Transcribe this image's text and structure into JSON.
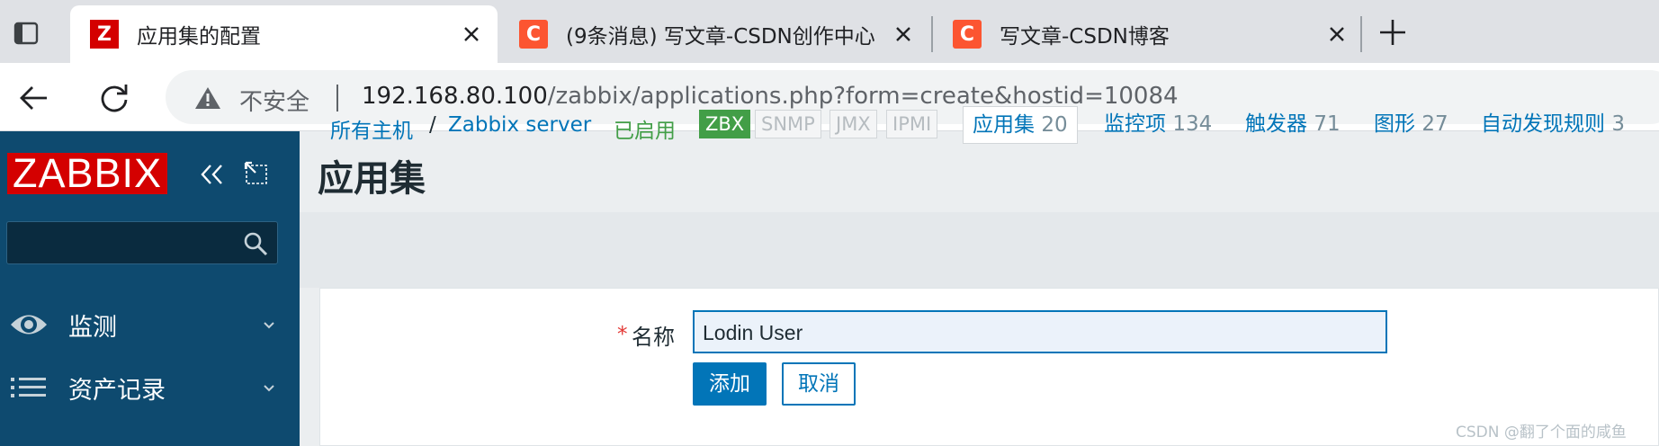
{
  "browser": {
    "tabs": [
      {
        "title": "应用集的配置",
        "favicon": "Z",
        "active": true
      },
      {
        "title": "(9条消息) 写文章-CSDN创作中心",
        "favicon": "C",
        "active": false
      },
      {
        "title": "写文章-CSDN博客",
        "favicon": "C",
        "active": false
      }
    ],
    "security_label": "不安全",
    "url_host": "192.168.80.100",
    "url_path": "/zabbix/applications.php?form=create&hostid=10084"
  },
  "sidebar": {
    "logo": "ZABBIX",
    "search_value": "",
    "items": [
      {
        "label": "监测",
        "icon": "eye-icon"
      },
      {
        "label": "资产记录",
        "icon": "list-icon"
      }
    ]
  },
  "main": {
    "title": "应用集",
    "breadcrumb": {
      "all_hosts": "所有主机",
      "separator": "/",
      "host": "Zabbix server"
    },
    "status": "已启用",
    "availability": [
      {
        "label": "ZBX",
        "on": true
      },
      {
        "label": "SNMP",
        "on": false
      },
      {
        "label": "JMX",
        "on": false
      },
      {
        "label": "IPMI",
        "on": false
      }
    ],
    "tabs": [
      {
        "label": "应用集",
        "count": "20",
        "active": true
      },
      {
        "label": "监控项",
        "count": "134"
      },
      {
        "label": "触发器",
        "count": "71"
      },
      {
        "label": "图形",
        "count": "27"
      },
      {
        "label": "自动发现规则",
        "count": "3"
      }
    ],
    "form": {
      "required_mark": "*",
      "name_label": "名称",
      "name_value": "Lodin User",
      "add_label": "添加",
      "cancel_label": "取消"
    }
  },
  "watermark": "CSDN @翻了个面的咸鱼",
  "colors": {
    "brand_red": "#d40000",
    "sidebar": "#0e4a6f",
    "link": "#0275b8",
    "enabled": "#429e47",
    "csdn": "#fc5531"
  }
}
